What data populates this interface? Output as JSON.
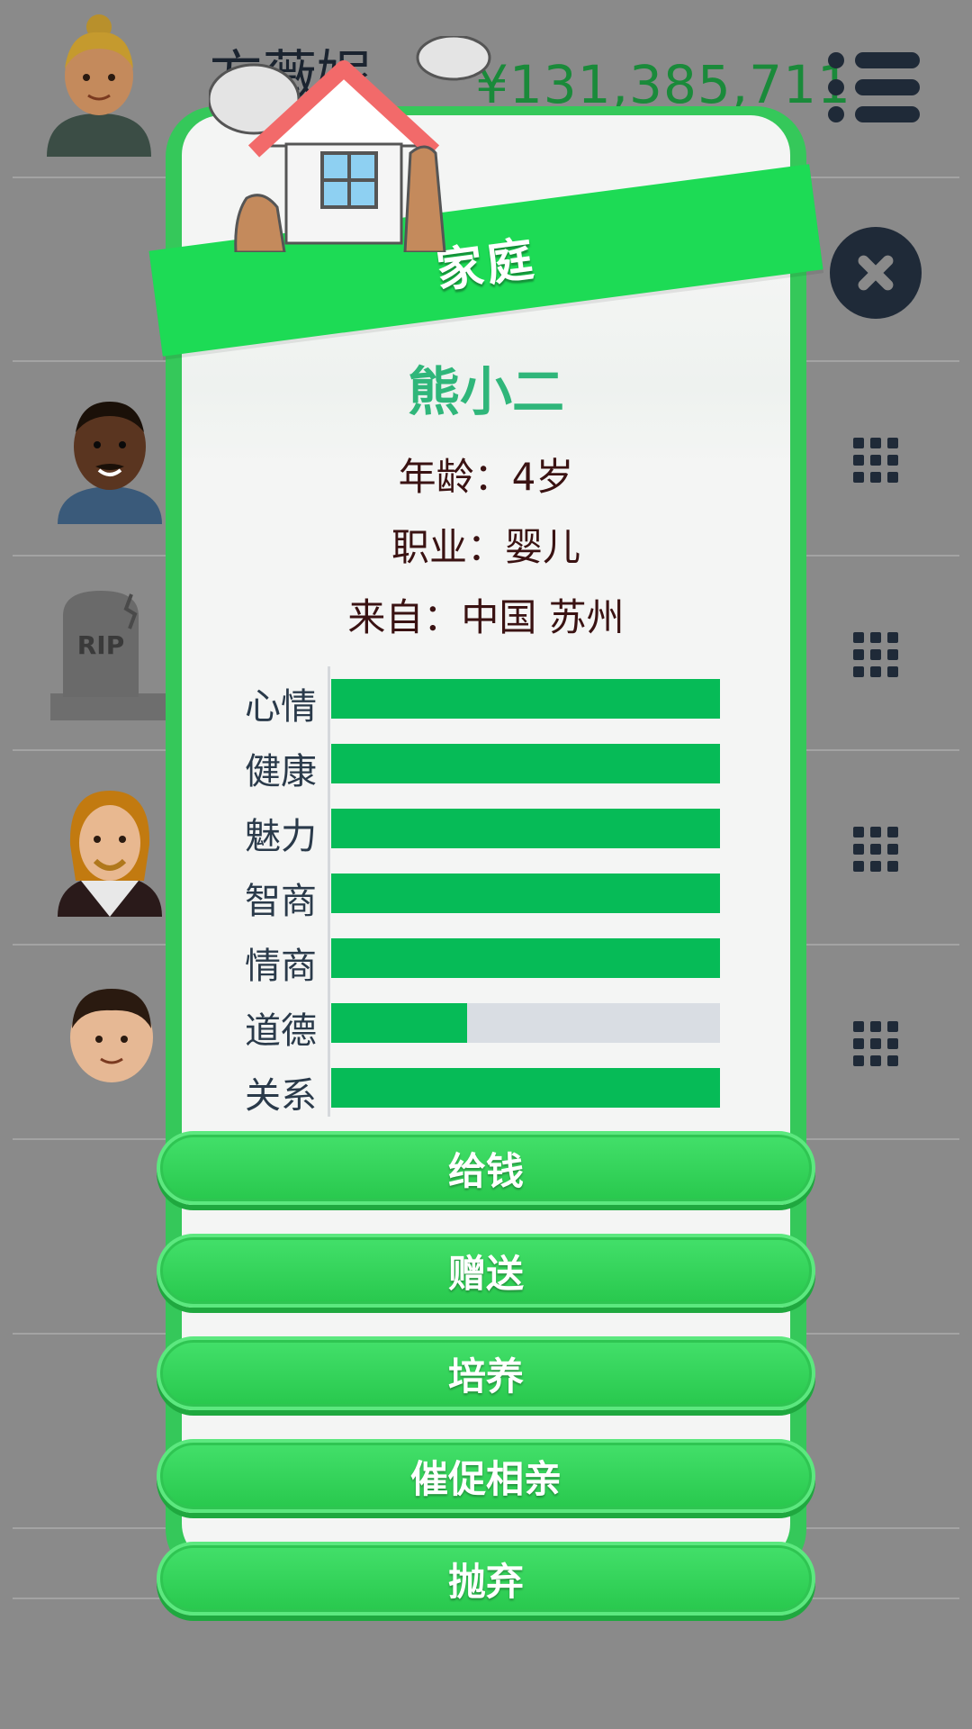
{
  "header": {
    "player_name": "方薇妮",
    "money": "¥131,385,711"
  },
  "modal": {
    "title": "家庭",
    "character_name": "熊小二",
    "age_line": "年龄：4岁",
    "job_line": "职业：婴儿",
    "from_line": "来自：中国 苏州",
    "stats": [
      {
        "label": "心情",
        "value": 1.0
      },
      {
        "label": "健康",
        "value": 1.0
      },
      {
        "label": "魅力",
        "value": 1.0
      },
      {
        "label": "智商",
        "value": 1.0
      },
      {
        "label": "情商",
        "value": 1.0
      },
      {
        "label": "道德",
        "value": 0.35
      },
      {
        "label": "关系",
        "value": 1.0
      }
    ],
    "actions": [
      "给钱",
      "赠送",
      "培养",
      "催促相亲",
      "抛弃"
    ]
  },
  "tombstone_text": "RIP",
  "colors": {
    "accent_green": "#1ddb55",
    "bar_fill": "#06bb57",
    "bar_track": "#d9dde3",
    "money_green": "#1a8a3a",
    "name_green": "#2fb67a"
  }
}
